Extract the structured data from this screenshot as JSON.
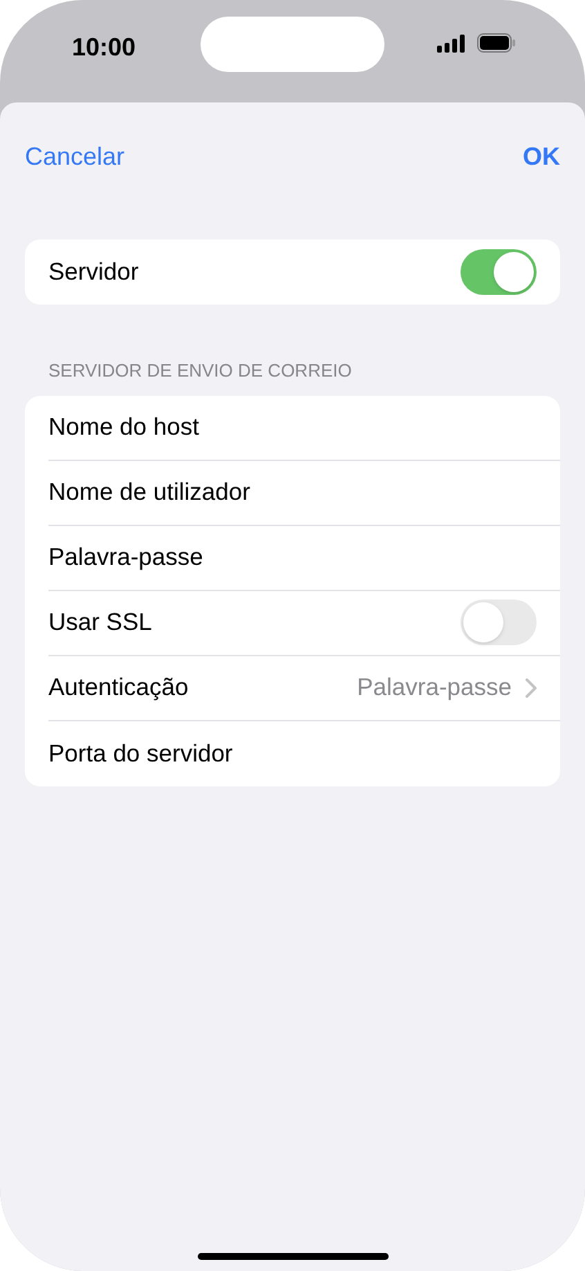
{
  "status_bar": {
    "time": "10:00"
  },
  "nav": {
    "cancel": "Cancelar",
    "confirm": "OK"
  },
  "server_group": {
    "rows": [
      {
        "kind": "toggle",
        "label": "Servidor",
        "on": true
      }
    ]
  },
  "outgoing_group": {
    "header": "SERVIDOR DE ENVIO DE CORREIO",
    "rows": [
      {
        "kind": "text",
        "label": "Nome do host"
      },
      {
        "kind": "text",
        "label": "Nome de utilizador"
      },
      {
        "kind": "text",
        "label": "Palavra-passe"
      },
      {
        "kind": "toggle",
        "label": "Usar SSL",
        "on": false
      },
      {
        "kind": "disclosure",
        "label": "Autenticação",
        "value": "Palavra-passe"
      },
      {
        "kind": "text",
        "label": "Porta do servidor"
      }
    ]
  }
}
